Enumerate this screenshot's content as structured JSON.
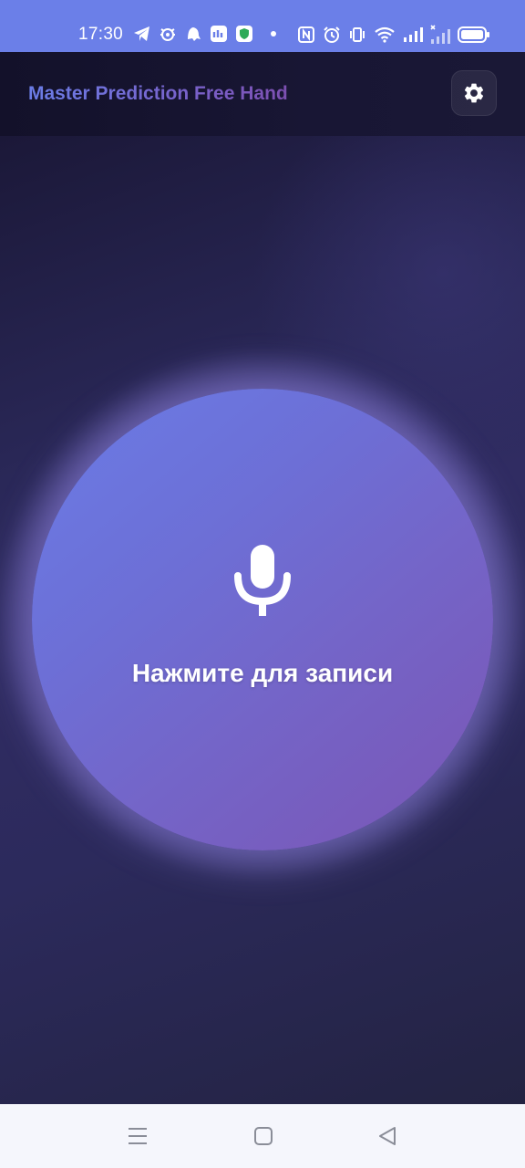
{
  "status_bar": {
    "time": "17:30",
    "icons_left": [
      "telegram-icon",
      "bug-icon",
      "ghost-icon",
      "app-icon",
      "shield-icon",
      "dot-icon"
    ],
    "icons_right": [
      "nfc-icon",
      "alarm-icon",
      "vibrate-icon",
      "wifi-icon",
      "signal-icon",
      "signal-no-service-icon",
      "battery-icon"
    ],
    "battery_level": 1.0
  },
  "app_bar": {
    "title": "Master Prediction Free Hand",
    "settings_icon": "gear-icon"
  },
  "main": {
    "record_label": "Нажмите для записи",
    "record_icon": "microphone-icon"
  },
  "nav_bar": {
    "items": [
      "menu-icon",
      "home-icon",
      "back-icon"
    ]
  },
  "colors": {
    "status_bar": "#6b7fe8",
    "accent_start": "#6a7ce6",
    "accent_end": "#7b55b4",
    "background": "#2a2858"
  }
}
